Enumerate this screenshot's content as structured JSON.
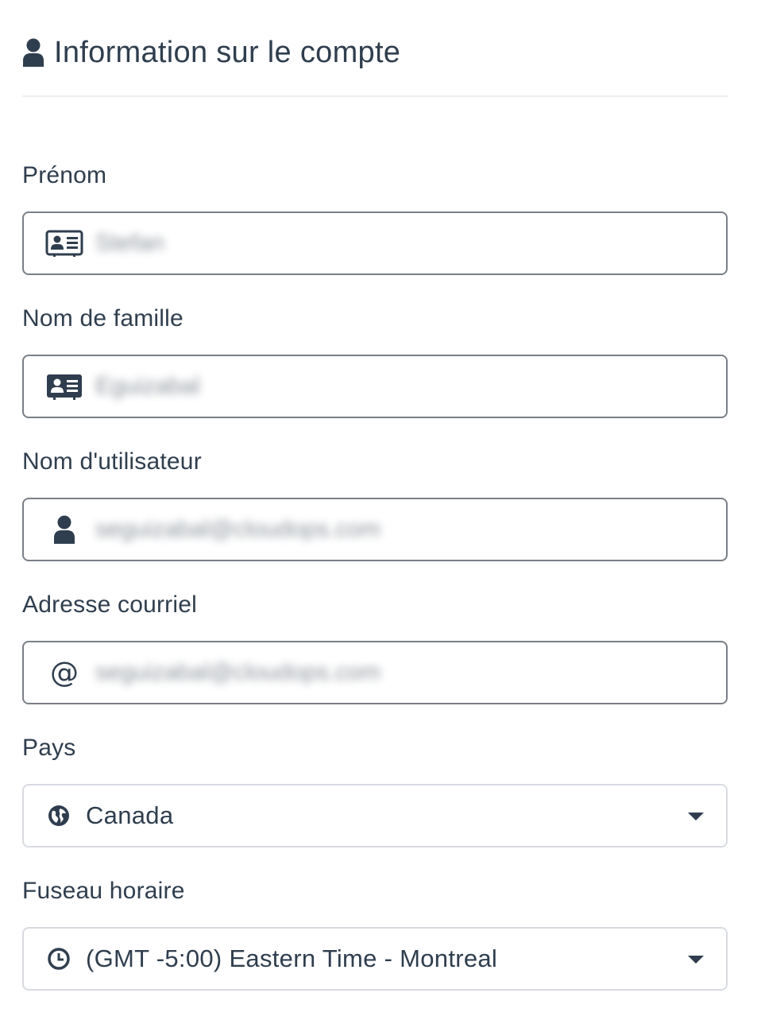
{
  "header": {
    "title": "Information sur le compte",
    "icon": "user-icon"
  },
  "fields": {
    "first_name": {
      "label": "Prénom",
      "value": "Stefan",
      "icon": "id-card-outline-icon"
    },
    "last_name": {
      "label": "Nom de famille",
      "value": "Eguizabal",
      "icon": "id-card-icon"
    },
    "username": {
      "label": "Nom d'utilisateur",
      "value": "seguizabal@cloudops.com",
      "icon": "user-icon"
    },
    "email": {
      "label": "Adresse courriel",
      "value": "seguizabal@cloudops.com",
      "icon": "at-icon",
      "icon_glyph": "@"
    },
    "country": {
      "label": "Pays",
      "value": "Canada",
      "icon": "globe-icon"
    },
    "timezone": {
      "label": "Fuseau horaire",
      "value": "(GMT -5:00) Eastern Time - Montreal",
      "icon": "clock-icon"
    }
  },
  "colors": {
    "text": "#2f3e4e",
    "border": "#7a7f86",
    "select_border": "#d8dbe0",
    "divider": "#eceff2"
  }
}
